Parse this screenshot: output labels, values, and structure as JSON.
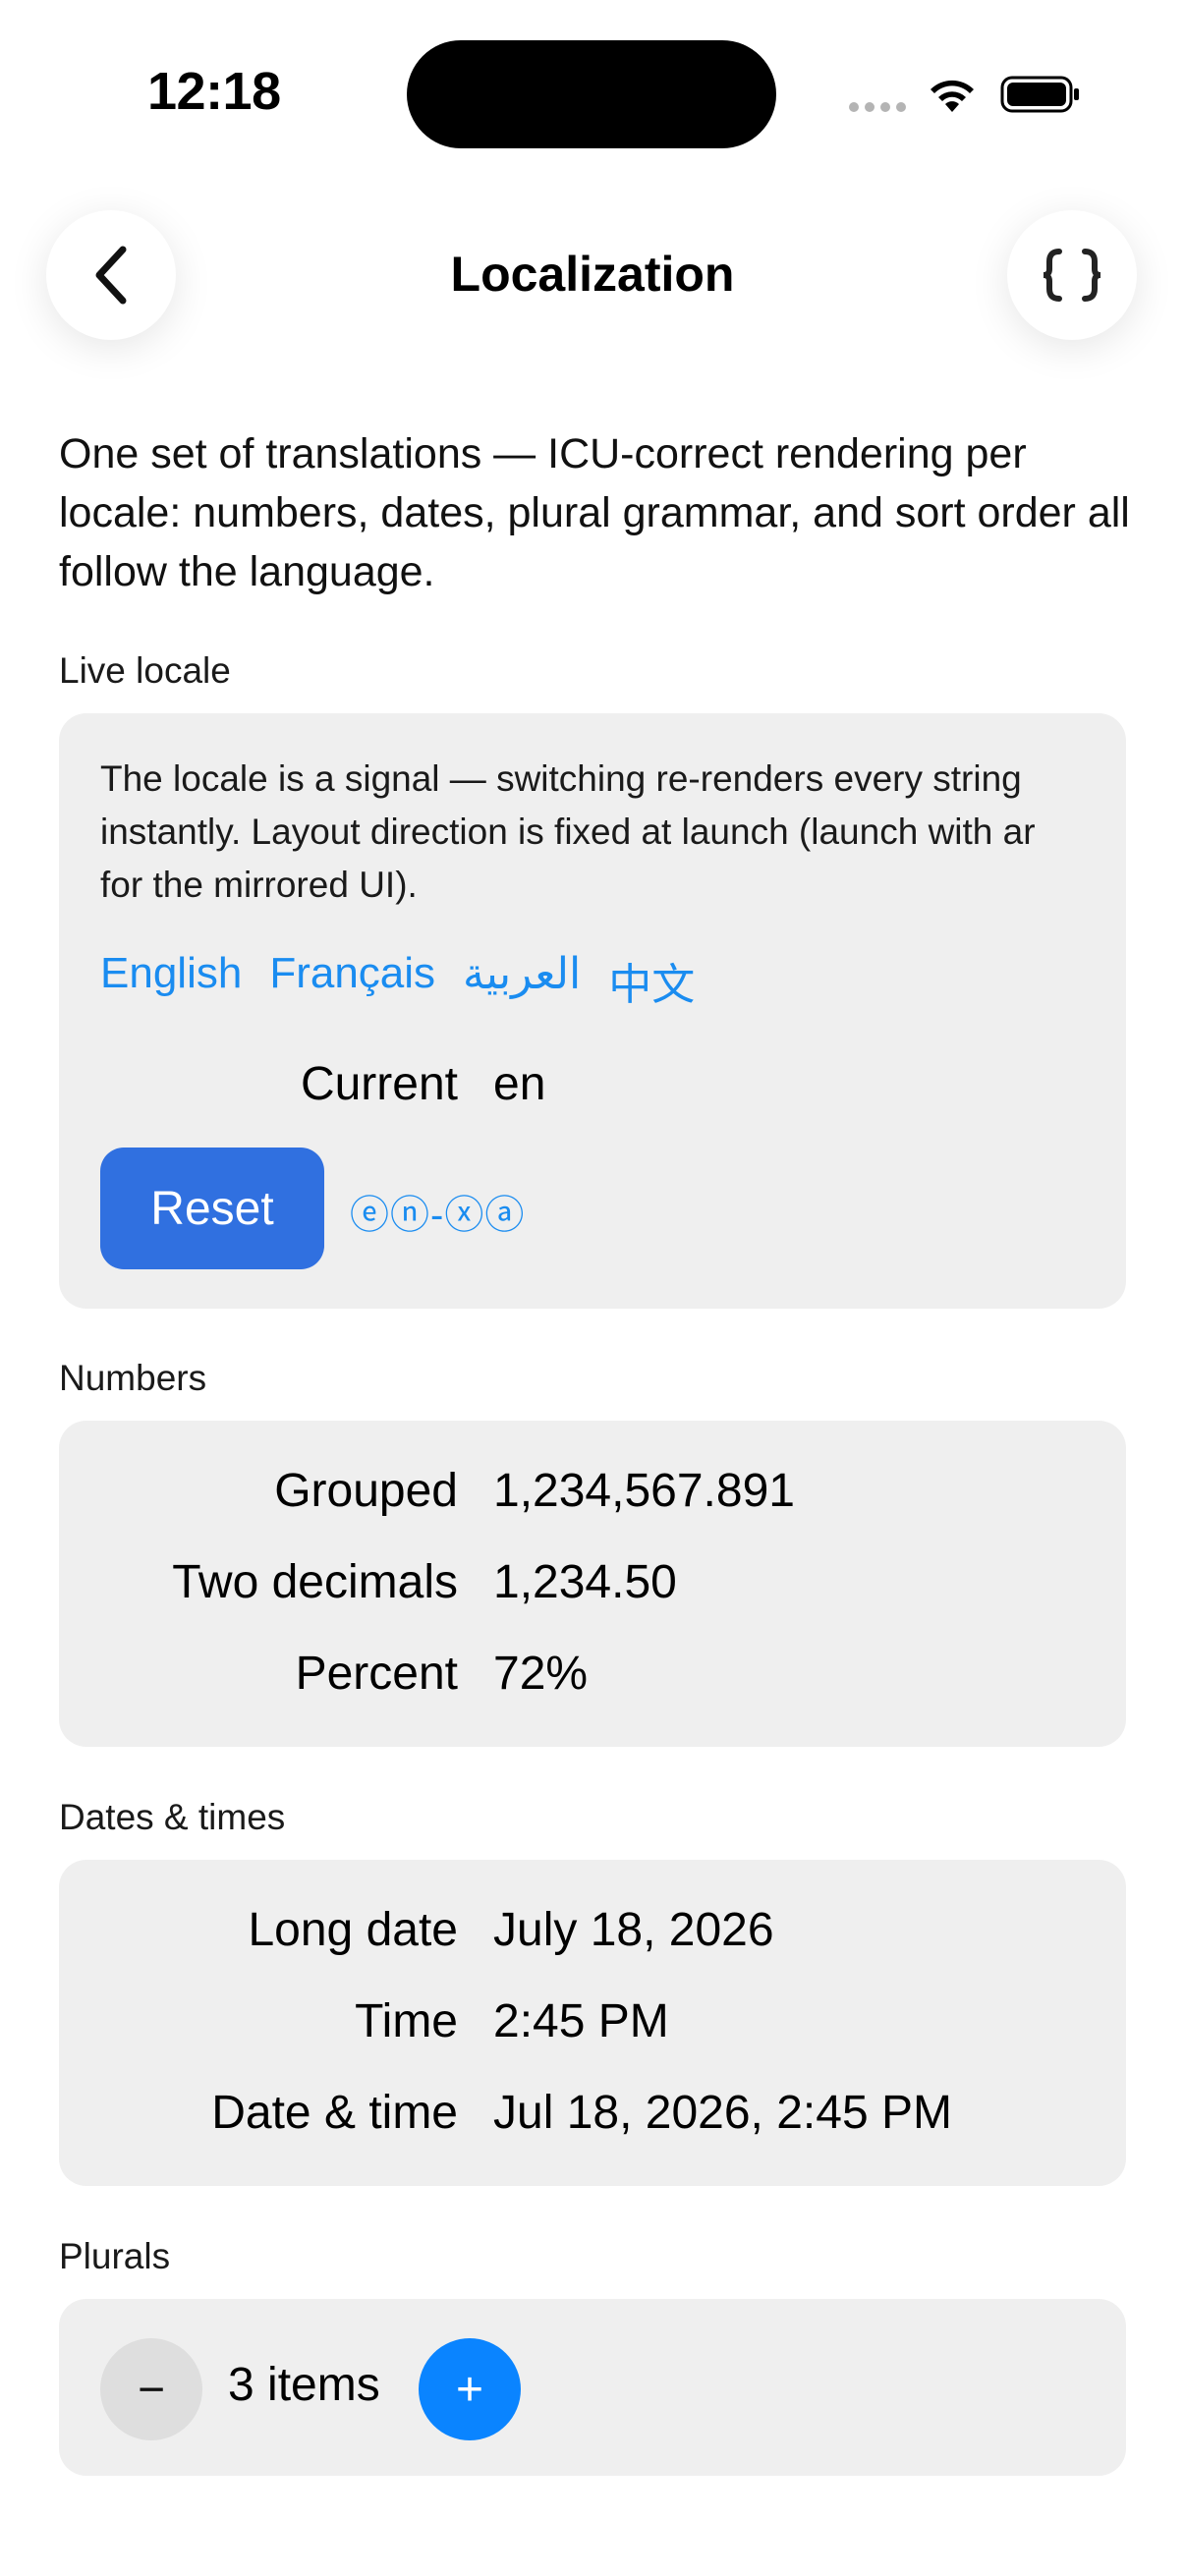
{
  "status": {
    "time": "12:18"
  },
  "nav": {
    "title": "Localization",
    "back_icon": "chevron-left-icon",
    "code_icon": "curly-braces-icon"
  },
  "intro": "One set of translations — ICU-correct rendering per locale: numbers, dates, plural grammar, and sort order all follow the language.",
  "live_locale": {
    "section_label": "Live locale",
    "description": "The locale is a signal — switching re-renders every string instantly. Layout direction is fixed at launch (launch with ar for the mirrored UI).",
    "languages": [
      "English",
      "Français",
      "العربية",
      "中文"
    ],
    "current_label": "Current",
    "current_value": "en",
    "reset_label": "Reset",
    "pseudo_label": "ⓔⓝ-ⓧⓐ"
  },
  "numbers": {
    "section_label": "Numbers",
    "rows": [
      {
        "label": "Grouped",
        "value": "1,234,567.891"
      },
      {
        "label": "Two decimals",
        "value": "1,234.50"
      },
      {
        "label": "Percent",
        "value": "72%"
      }
    ]
  },
  "dates": {
    "section_label": "Dates & times",
    "rows": [
      {
        "label": "Long date",
        "value": "July 18, 2026"
      },
      {
        "label": "Time",
        "value": "2:45 PM"
      },
      {
        "label": "Date & time",
        "value": "Jul 18, 2026, 2:45 PM"
      }
    ]
  },
  "plurals": {
    "section_label": "Plurals",
    "minus_label": "−",
    "count_text": "3 items",
    "plus_label": "+"
  },
  "colors": {
    "accent": "#1a8cf0",
    "reset_button": "#3070e0",
    "plus_button": "#0a84ff",
    "card_background": "#efefef"
  }
}
